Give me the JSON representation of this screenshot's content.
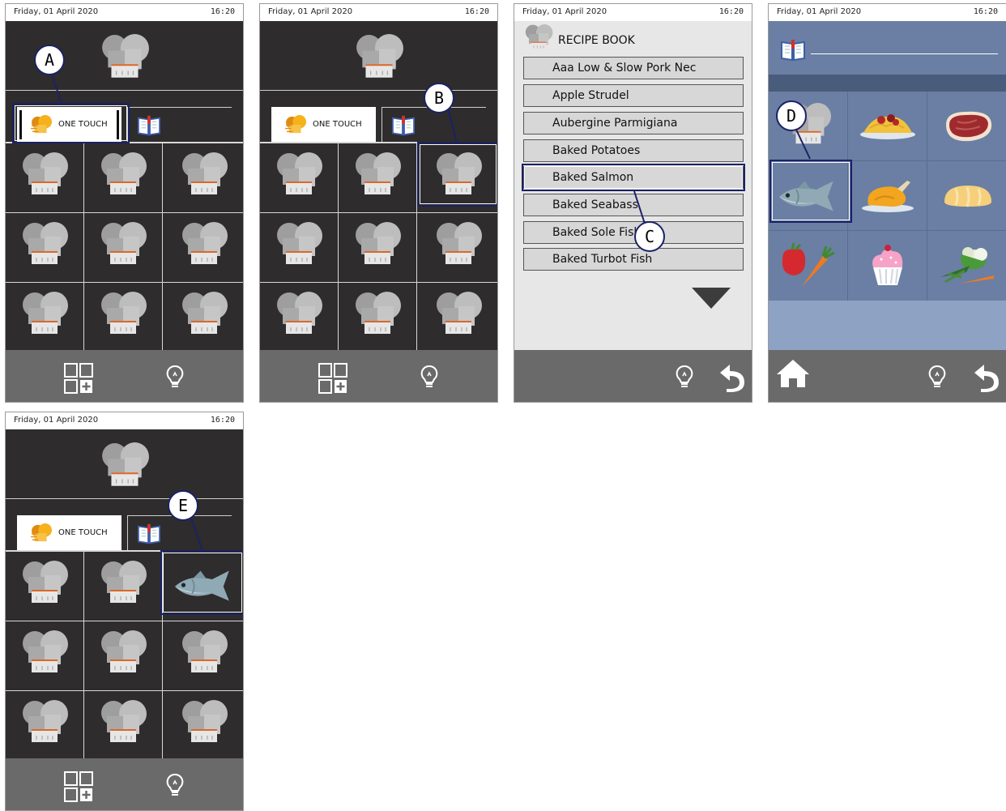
{
  "status": {
    "date": "Friday, 01 April 2020",
    "time": "16:20"
  },
  "tabs": {
    "one_touch": "ONE TOUCH"
  },
  "recipe_book": {
    "title": "RECIPE BOOK",
    "items": [
      "Aaa Low & Slow Pork Nec",
      "Apple Strudel",
      "Aubergine Parmigiana",
      "Baked Potatoes",
      "Baked Salmon",
      "Baked Seabass",
      "Baked Sole Fish",
      "Baked Turbot Fish"
    ]
  },
  "callouts": {
    "a": "A",
    "b": "B",
    "c": "C",
    "d": "D",
    "e": "E"
  },
  "categories": [
    "chef-hat-icon",
    "pasta-icon",
    "steak-icon",
    "fish-icon",
    "roast-chicken-icon",
    "bread-icon",
    "vegetables-icon",
    "cupcake-icon",
    "greens-icon"
  ]
}
